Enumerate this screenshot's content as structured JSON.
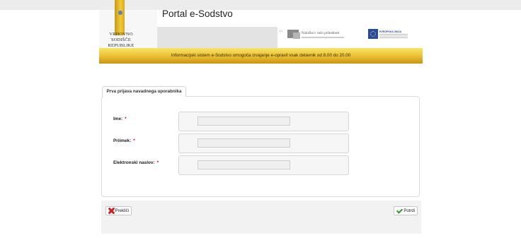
{
  "header": {
    "logo_text": [
      "VRHOVNO SODIŠČE",
      "REPUBLIKE SLOVENIJE"
    ],
    "portal_title": "Portal e-Sodstvo",
    "partner1_text": "Naložba v vašo prihodnost",
    "partner2_text": "EVROPSKA UNIJA",
    "banner_text": "Informacijski sistem e-Sodstvo omogoča izvajanje e-opravil vsak delavnik od 8.00 do 20.00"
  },
  "form": {
    "tab_label": "Prva prijava navadnega uporabnika",
    "fields": [
      {
        "label": "Ime:",
        "required": "*",
        "value": ""
      },
      {
        "label": "Priimek:",
        "required": "*",
        "value": ""
      },
      {
        "label": "Elektronski naslov:",
        "required": "*",
        "value": ""
      }
    ]
  },
  "footer": {
    "cancel_label": "Prekliči",
    "confirm_label": "Potrdi"
  },
  "colors": {
    "banner_gold": "#eec53a",
    "required_red": "#d40000",
    "cancel_icon": "#d01f1f",
    "confirm_icon": "#2f9a2f"
  },
  "icons": [
    "cancel-x-icon",
    "confirm-check-icon",
    "eu-flag-icon"
  ]
}
